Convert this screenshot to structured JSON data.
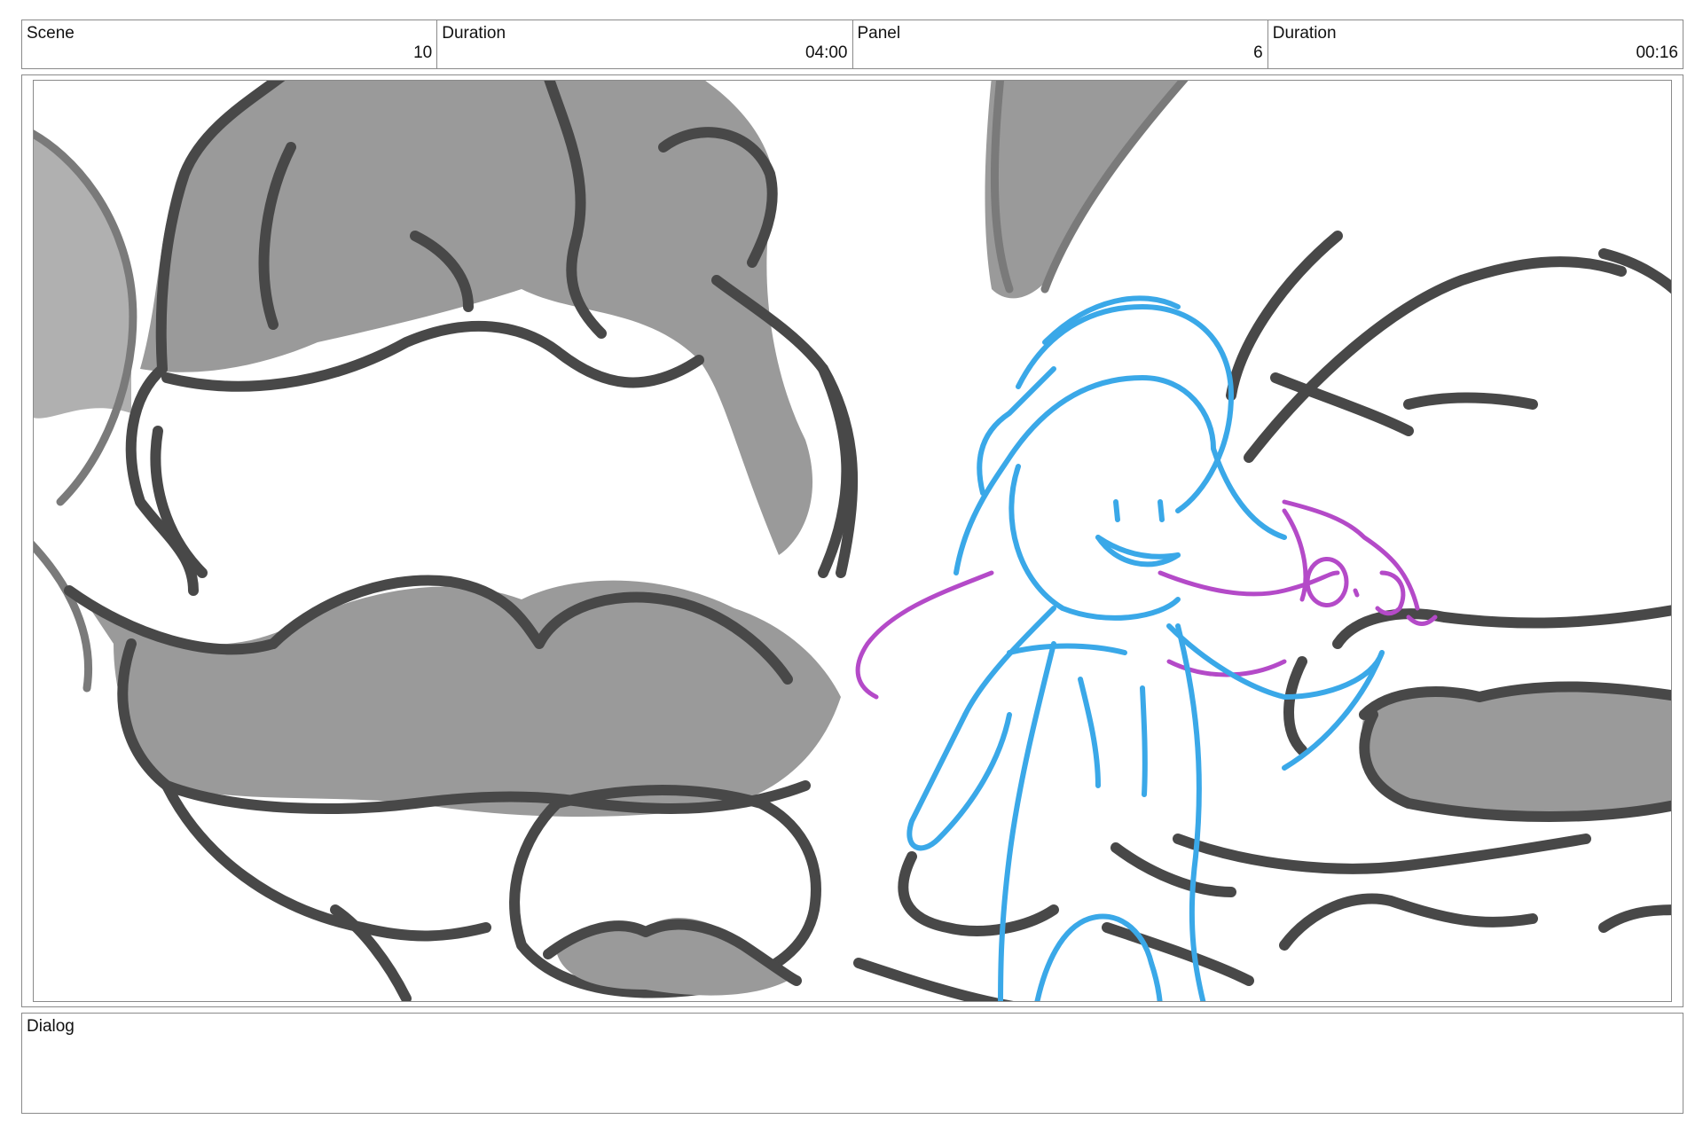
{
  "header": {
    "scene": {
      "label": "Scene",
      "value": "10"
    },
    "scene_duration": {
      "label": "Duration",
      "value": "04:00"
    },
    "panel": {
      "label": "Panel",
      "value": "6"
    },
    "panel_duration": {
      "label": "Duration",
      "value": "00:16"
    }
  },
  "dialog": {
    "label": "Dialog",
    "text": ""
  },
  "colors": {
    "grey_fill": "#9a9a9a",
    "line": "#484848",
    "character_blue": "#3aa8e8",
    "creature_purple": "#b44ac8"
  }
}
